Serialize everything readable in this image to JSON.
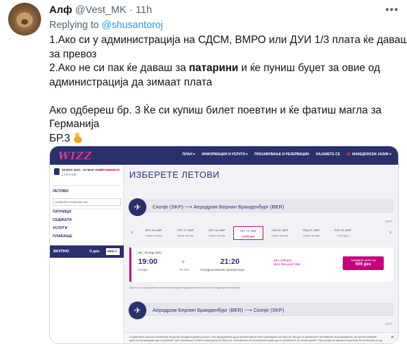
{
  "tweet": {
    "display_name": "Алф",
    "handle": "@Vest_MK",
    "separator": "·",
    "time": "11h",
    "reply_prefix": "Replying to ",
    "reply_to": "@shusantoroj",
    "lines": {
      "l1": "1.Ако си у администрација на СДСМ, ВМРО или ДУИ 1/3 плата ќе даваш",
      "l2": "за превоз",
      "l3a": "2.Ако не си пак ќе даваш за ",
      "l3b": "патарини",
      "l3c": " и ќе пуниш буџет за овие од",
      "l4": "администрација да зимаат плата",
      "l5": "Ако одбереш бр. 3 Ќе си купиш билет поевтин и ќе фатиш магла за",
      "l6": "Германија",
      "l7": "БР.3"
    },
    "emoji": "pointing-down-emoji"
  },
  "screenshot": {
    "logo": "WIZZ",
    "nav": [
      "ПЛАН ▾",
      "ИНФОРМАЦИИ И УСЛУГИ ▾",
      "ПРИЈАВУВАЊЕ И РЕЗЕРВАЦИИ",
      "НАЈАВЕТЕ СЕ",
      "МАКЕДОНСКИ ЈАЗИК ▾"
    ],
    "sidebar": {
      "trip_dates": "19 МАР 2021 - 22 МАР 2021",
      "trip_passengers": "1 ПАТНИК",
      "edit": "ПРОМЕНЕТЕ",
      "section_flights": "ЛЕТОВИ",
      "choose_flight": "Изберете поаѓачки лет.",
      "passengers": "ПАТНИЦИ",
      "seats": "СЕДИШТА",
      "services": "УСЛУГИ",
      "payment": "ПЛАЌАЊЕ",
      "total_label": "ВКУПНО",
      "total_value": "0 ден",
      "currency": "MKD ▾"
    },
    "page_title": "ИЗБЕРЕТЕ ЛЕТОВИ",
    "outbound": {
      "route": "Скопје (SKP) ⟶ Аеродром Берлин Бранденбург (BER)",
      "month": "МАРТ",
      "dates": [
        {
          "day": "ВТО 16, МАР",
          "price": "Нема летови"
        },
        {
          "day": "СРЕ 17, МАР",
          "price": "Нема летови"
        },
        {
          "day": "ЧЕТ 18, МАР",
          "price": "Нема летови"
        },
        {
          "day": "ПЕТ 19, МАР",
          "price": "1.229 ден"
        },
        {
          "day": "САБ 20, МАР",
          "price": "Нема летови"
        },
        {
          "day": "НЕД 21, МАР",
          "price": "Нема летови"
        },
        {
          "day": "ПОН 22, МАР",
          "price": "1.539 ден"
        }
      ],
      "flight": {
        "date": "пет, 19 мар 2021",
        "dep_time": "19:00",
        "dep_city": "Скопје",
        "duration": "2h 20m",
        "arr_time": "21:20",
        "arr_city": "Аеродром Берлин Бранденбург",
        "fare1": "од 1.229 ден",
        "fare2": "Wizz Discount Club",
        "button_label": "пријавни цени од",
        "button_price": "609 ден"
      }
    },
    "note": "Цени што се прикажани по патник и вклучуваат една рачна чанта. Цените се подложни на промени.",
    "return": {
      "route": "Аеродром Берлин Бранденбург (BER) ⟶ Скопје (SKP)",
      "month": "МАРТ"
    },
    "cookie_text": "Страницата користи колачиња за да Ви понуди подобри услуги. Ако продолжите да ја прелистувате веб-страницата на Wizz Air без да ги промените поставките за колачињата, ќе претпоставиме дека се согласувате да ги примате сите колачиња на веб-страницата на Wizz Air. Поставките за колачињата може да ги промените во секое време. Прочитајте ја нашата Политика за колачиња за да дознаете повеќе!",
    "cookie_close": "✕"
  }
}
